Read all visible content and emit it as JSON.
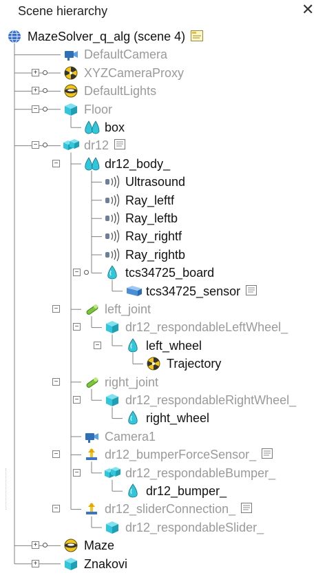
{
  "panel": {
    "title": "Scene hierarchy"
  },
  "colors": {
    "cyan": "#33c5d9",
    "yellow": "#f2c51b",
    "green": "#7cc43a",
    "dim_text": "#9a9a9a",
    "lines": "#808080"
  },
  "tree": [
    {
      "label": "MazeSolver_q_alg (scene 4)",
      "icon": "globe-icon",
      "level": 0,
      "dim": false,
      "script": "scene-script-icon"
    },
    {
      "label": "DefaultCamera",
      "icon": "camera-icon",
      "level": 1,
      "dim": true
    },
    {
      "label": "XYZCameraProxy",
      "icon": "dummy-icon",
      "level": 1,
      "dim": true,
      "expander": "+",
      "knob": true
    },
    {
      "label": "DefaultLights",
      "icon": "light-icon",
      "level": 1,
      "dim": true,
      "expander": "+",
      "knob": true
    },
    {
      "label": "Floor",
      "icon": "cuboid-icon",
      "level": 1,
      "dim": true,
      "expander": "-",
      "knob": true
    },
    {
      "label": "box",
      "icon": "compound-shape-icon",
      "level": 2,
      "dim": false
    },
    {
      "label": "dr12",
      "icon": "compound-cuboid-icon",
      "level": 1,
      "dim": true,
      "expander": "-",
      "knob": true,
      "script": "child-script-icon"
    },
    {
      "label": "dr12_body_",
      "icon": "compound-shape-icon",
      "level": 2,
      "dim": false,
      "expander": "-"
    },
    {
      "label": "Ultrasound",
      "icon": "proximity-sensor-icon",
      "level": 3,
      "dim": false
    },
    {
      "label": "Ray_leftf",
      "icon": "proximity-sensor-icon",
      "level": 3,
      "dim": false
    },
    {
      "label": "Ray_leftb",
      "icon": "proximity-sensor-icon",
      "level": 3,
      "dim": false
    },
    {
      "label": "Ray_rightf",
      "icon": "proximity-sensor-icon",
      "level": 3,
      "dim": false
    },
    {
      "label": "Ray_rightb",
      "icon": "proximity-sensor-icon",
      "level": 3,
      "dim": false
    },
    {
      "label": "tcs34725_board",
      "icon": "shape-icon",
      "level": 3,
      "dim": false,
      "expander": "-",
      "knob": true
    },
    {
      "label": "tcs34725_sensor",
      "icon": "vision-sensor-icon",
      "level": 4,
      "dim": false,
      "script": "child-script-icon"
    },
    {
      "label": "left_joint",
      "icon": "joint-icon",
      "level": 2,
      "dim": true,
      "expander": "-"
    },
    {
      "label": "dr12_respondableLeftWheel_",
      "icon": "cuboid-icon",
      "level": 3,
      "dim": true,
      "expander": "-"
    },
    {
      "label": "left_wheel",
      "icon": "shape-icon",
      "level": 4,
      "dim": false,
      "expander": "-"
    },
    {
      "label": "Trajectory",
      "icon": "dummy-icon",
      "level": 5,
      "dim": false
    },
    {
      "label": "right_joint",
      "icon": "joint-icon",
      "level": 2,
      "dim": true,
      "expander": "-"
    },
    {
      "label": "dr12_respondableRightWheel_",
      "icon": "cuboid-icon",
      "level": 3,
      "dim": true,
      "expander": "-"
    },
    {
      "label": "right_wheel",
      "icon": "shape-icon",
      "level": 4,
      "dim": false
    },
    {
      "label": "Camera1",
      "icon": "camera-icon",
      "level": 2,
      "dim": true
    },
    {
      "label": "dr12_bumperForceSensor_",
      "icon": "force-sensor-icon",
      "level": 2,
      "dim": true,
      "expander": "-",
      "script": "child-script-icon"
    },
    {
      "label": "dr12_respondableBumper_",
      "icon": "compound-cuboid-icon",
      "level": 3,
      "dim": true,
      "expander": "-"
    },
    {
      "label": "dr12_bumper_",
      "icon": "shape-icon",
      "level": 4,
      "dim": false
    },
    {
      "label": "dr12_sliderConnection_",
      "icon": "force-sensor-icon",
      "level": 2,
      "dim": true,
      "expander": "-",
      "script": "child-script-icon"
    },
    {
      "label": "dr12_respondableSlider_",
      "icon": "cuboid-icon",
      "level": 3,
      "dim": true
    },
    {
      "label": "Maze",
      "icon": "light-icon",
      "level": 1,
      "dim": false,
      "expander": "+",
      "knob": true
    },
    {
      "label": "Znakovi",
      "icon": "cuboid-icon",
      "level": 1,
      "dim": false,
      "expander": "+"
    }
  ]
}
